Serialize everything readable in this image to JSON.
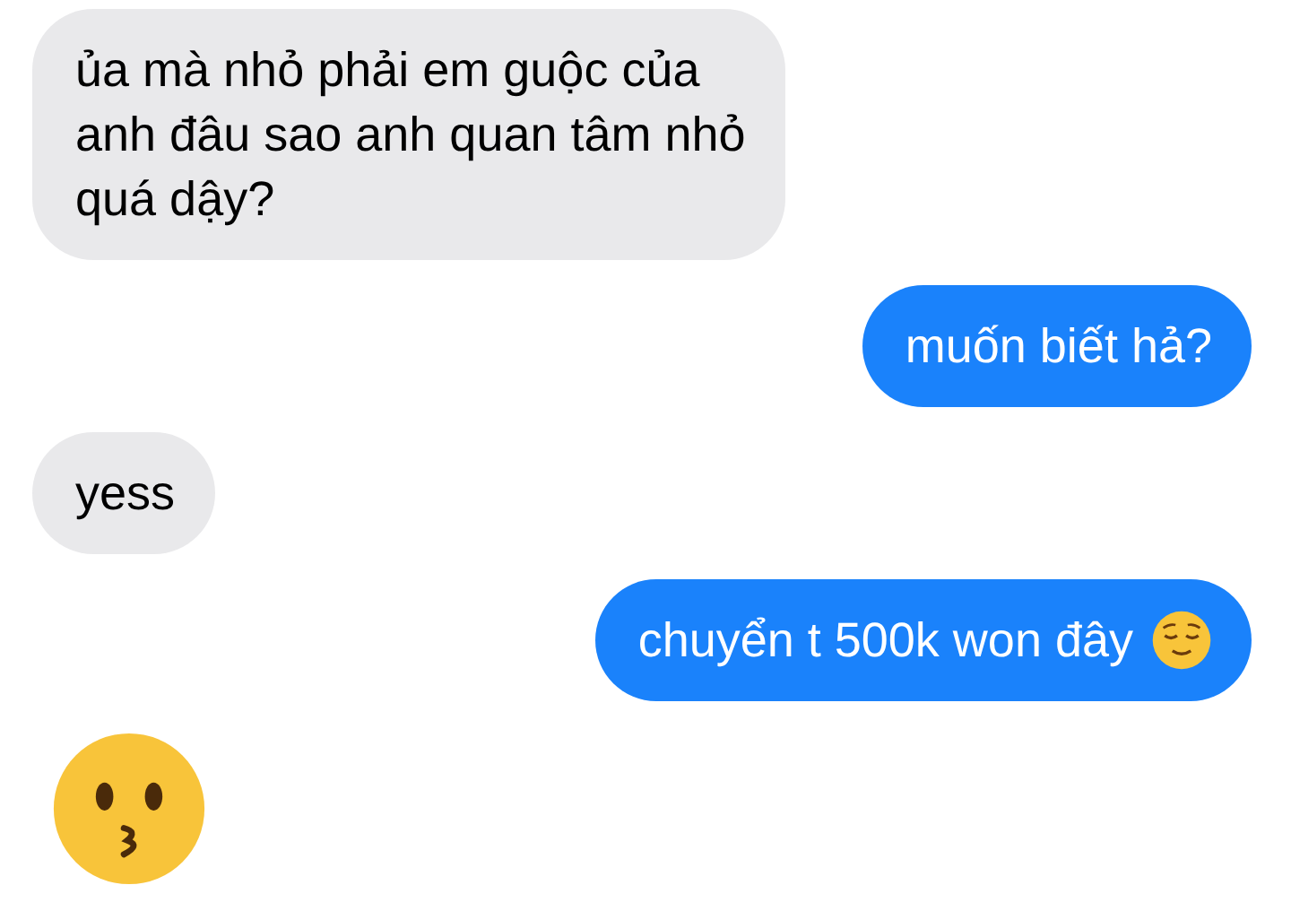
{
  "messages": [
    {
      "kind": "text",
      "outgoing": false,
      "lines": [
        "ủa mà nhỏ phải em guộc của",
        "anh đâu sao anh quan tâm nhỏ",
        "quá dậy?"
      ]
    },
    {
      "kind": "text",
      "outgoing": true,
      "lines": [
        "muốn biết hả?"
      ]
    },
    {
      "kind": "text",
      "outgoing": false,
      "lines": [
        "yess"
      ]
    },
    {
      "kind": "text-emoji",
      "outgoing": true,
      "lines": [
        "chuyển t 500k won đây"
      ]
    },
    {
      "kind": "emoji",
      "outgoing": false
    }
  ]
}
